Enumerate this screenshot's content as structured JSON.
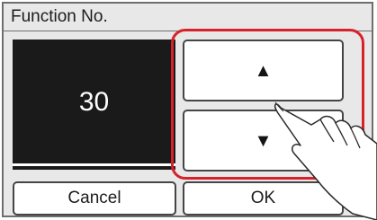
{
  "dialog": {
    "title": "Function No."
  },
  "value": {
    "current": "30"
  },
  "stepper": {
    "up_glyph": "▲",
    "down_glyph": "▼"
  },
  "buttons": {
    "cancel_label": "Cancel",
    "ok_label": "OK"
  },
  "colors": {
    "highlight": "#d8222b",
    "panel": "#1a1a1a",
    "background": "#e8e8e8"
  },
  "icons": {
    "pointer": "hand-pointer-icon"
  }
}
